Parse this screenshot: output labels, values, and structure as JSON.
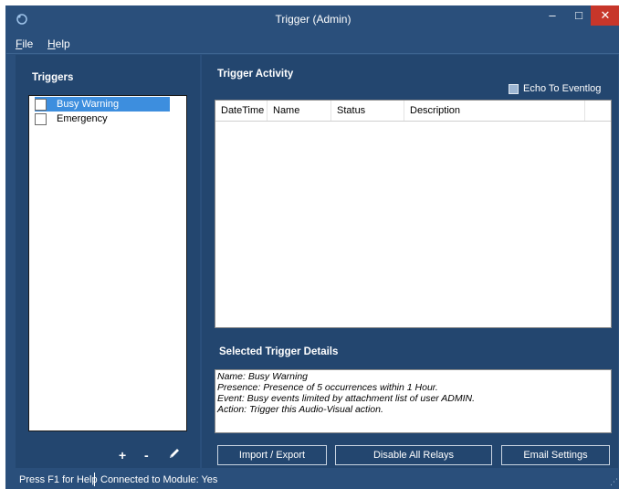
{
  "window": {
    "title": "Trigger (Admin)",
    "controls": {
      "minimize": "–",
      "maximize": "□",
      "close": "✕"
    },
    "accent": "#2a4f7b",
    "close_color": "#c7362a"
  },
  "menu": {
    "file": "File",
    "help": "Help"
  },
  "triggers": {
    "title": "Triggers",
    "items": [
      {
        "label": "Busy Warning",
        "selected": true
      },
      {
        "label": "Emergency",
        "selected": false
      }
    ],
    "tools": {
      "add": "+",
      "remove": "-",
      "edit_icon": "pencil-icon"
    }
  },
  "activity": {
    "title": "Trigger Activity",
    "echo_label": "Echo To Eventlog",
    "columns": [
      "DateTime",
      "Name",
      "Status",
      "Description"
    ]
  },
  "details": {
    "title": "Selected Trigger Details",
    "lines": [
      "Name:  Busy Warning",
      "Presence: Presence of 5 occurrences within 1 Hour.",
      "Event:  Busy events limited by attachment list of user ADMIN.",
      "Action:  Trigger this Audio-Visual action."
    ]
  },
  "buttons": {
    "import_export": "Import / Export",
    "disable_relays": "Disable All Relays",
    "email_settings": "Email Settings"
  },
  "status": {
    "help": "Press F1 for Help",
    "connection": "Connected to Module: Yes"
  }
}
